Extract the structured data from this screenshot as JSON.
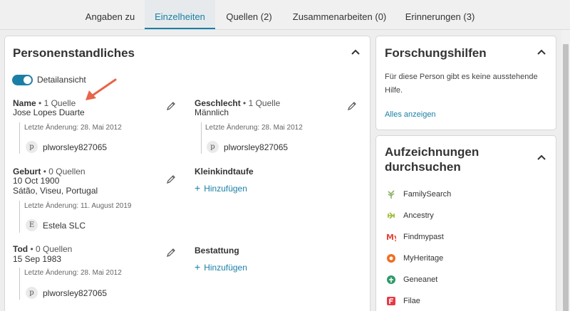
{
  "tabs": [
    {
      "label": "Angaben zu"
    },
    {
      "label": "Einzelheiten"
    },
    {
      "label": "Quellen (2)"
    },
    {
      "label": "Zusammenarbeiten (0)"
    },
    {
      "label": "Erinnerungen (3)"
    }
  ],
  "active_tab": "Einzelheiten",
  "person_panel": {
    "title": "Personenstandliches",
    "toggle_label": "Detailansicht",
    "toggle_on": true,
    "facts": {
      "name": {
        "label": "Name",
        "sources": "• 1 Quelle",
        "values": [
          "Jose Lopes Duarte"
        ],
        "changed": "Letzte Änderung: 28. Mai 2012",
        "contributor_initial": "p",
        "contributor": "plworsley827065"
      },
      "gender": {
        "label": "Geschlecht",
        "sources": "• 1 Quelle",
        "values": [
          "Männlich"
        ],
        "changed": "Letzte Änderung: 28. Mai 2012",
        "contributor_initial": "p",
        "contributor": "plworsley827065"
      },
      "birth": {
        "label": "Geburt",
        "sources": "• 0 Quellen",
        "values": [
          "10 Oct 1900",
          "Sátão, Viseu, Portugal"
        ],
        "changed": "Letzte Änderung: 11. August 2019",
        "contributor_initial": "E",
        "contributor": "Estela SLC"
      },
      "christening": {
        "label": "Kleinkindtaufe",
        "add_label": "Hinzufügen"
      },
      "death": {
        "label": "Tod",
        "sources": "• 0 Quellen",
        "values": [
          "15 Sep 1983"
        ],
        "changed": "Letzte Änderung: 28. Mai 2012",
        "contributor_initial": "p",
        "contributor": "plworsley827065"
      },
      "burial": {
        "label": "Bestattung",
        "add_label": "Hinzufügen"
      }
    }
  },
  "research_panel": {
    "title": "Forschungshilfen",
    "text_line1": "Für diese Person gibt es keine ausstehende",
    "text_line2": "Hilfe.",
    "link": "Alles anzeigen"
  },
  "records_panel": {
    "title_line1": "Aufzeichnungen",
    "title_line2": "durchsuchen",
    "items": [
      {
        "label": "FamilySearch",
        "icon": "familysearch-tree-icon",
        "color": "#8cb369"
      },
      {
        "label": "Ancestry",
        "icon": "ancestry-leaf-icon",
        "color": "#9bbb32"
      },
      {
        "label": "Findmypast",
        "icon": "findmypast-icon",
        "color": "#e4463c"
      },
      {
        "label": "MyHeritage",
        "icon": "myheritage-icon",
        "color": "#f26d21"
      },
      {
        "label": "Geneanet",
        "icon": "geneanet-icon",
        "color": "#2e9a6a"
      },
      {
        "label": "Filae",
        "icon": "filae-icon",
        "color": "#e63946"
      }
    ]
  },
  "colors": {
    "accent": "#1a7fa6",
    "annotation_arrow": "#e8644a"
  }
}
